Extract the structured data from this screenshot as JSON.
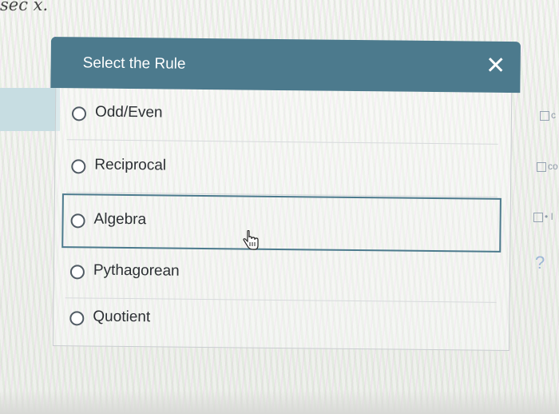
{
  "background": {
    "math_text": "sec x.",
    "right_edge_fragments": [
      "c",
      "co",
      "• I"
    ],
    "help_glyph": "?",
    "colors": {
      "teal_strip": "#c7dde2",
      "help": "#9db7d6"
    }
  },
  "dialog": {
    "title": "Select the Rule",
    "close_glyph": "✕",
    "colors": {
      "header": "#4c7a8d",
      "header_text": "#ffffff",
      "option_text": "#2b2f33"
    },
    "options": [
      {
        "label": "Odd/Even"
      },
      {
        "label": "Reciprocal"
      },
      {
        "label": "Algebra",
        "highlighted": true
      },
      {
        "label": "Pythagorean"
      },
      {
        "label": "Quotient"
      }
    ]
  },
  "cursor": {
    "type": "pointer-hand-icon"
  }
}
